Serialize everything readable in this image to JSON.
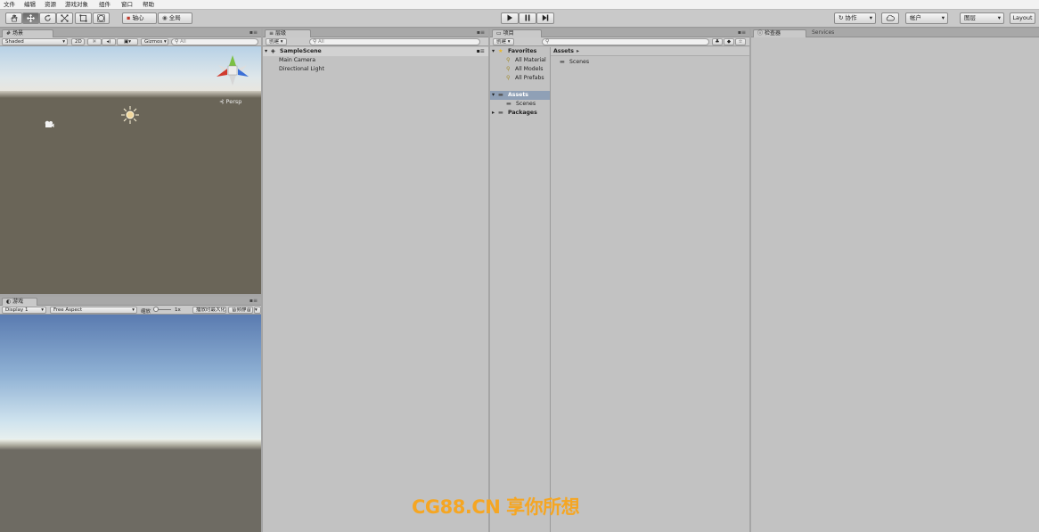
{
  "menu": [
    "文件",
    "编辑",
    "资源",
    "游戏对象",
    "组件",
    "窗口",
    "帮助"
  ],
  "toolbar": {
    "tools": [
      "hand-tool",
      "move-tool",
      "rotate-tool",
      "scale-tool",
      "rect-tool",
      "transform-tool"
    ],
    "pivot_label": "轴心",
    "global_label": "全局",
    "collab_label": "协作",
    "account_label": "帐户",
    "layers_label": "图层",
    "layout_label": "Layout"
  },
  "scene": {
    "tab": "场景",
    "shading": "Shaded",
    "mode2d": "2D",
    "gizmos": "Gizmos",
    "search_placeholder": "All",
    "persp_label": "Persp"
  },
  "game": {
    "tab": "游戏",
    "display": "Display 1",
    "aspect": "Free Aspect",
    "scale_label": "缩放",
    "scale_value": "1x",
    "maximize_label": "播放时最大化",
    "mute_label": "音频静音"
  },
  "hierarchy": {
    "tab": "层级",
    "create_label": "创建",
    "search_placeholder": "All",
    "scene_name": "SampleScene",
    "items": [
      "Main Camera",
      "Directional Light"
    ]
  },
  "project": {
    "tab": "项目",
    "create_label": "创建",
    "favorites_label": "Favorites",
    "favorites": [
      "All Material",
      "All Models",
      "All Prefabs"
    ],
    "assets_label": "Assets",
    "asset_children": [
      "Scenes"
    ],
    "packages_label": "Packages",
    "breadcrumb": "Assets",
    "breadcrumb_arrow": "▸",
    "grid_items": [
      "Scenes"
    ]
  },
  "inspector": {
    "tab": "检查器",
    "services_tab": "Services"
  },
  "watermark": "CG88.CN 享你所想",
  "colors": {
    "accent_selected": "#8fa0b6",
    "watermark": "#f5a623"
  }
}
